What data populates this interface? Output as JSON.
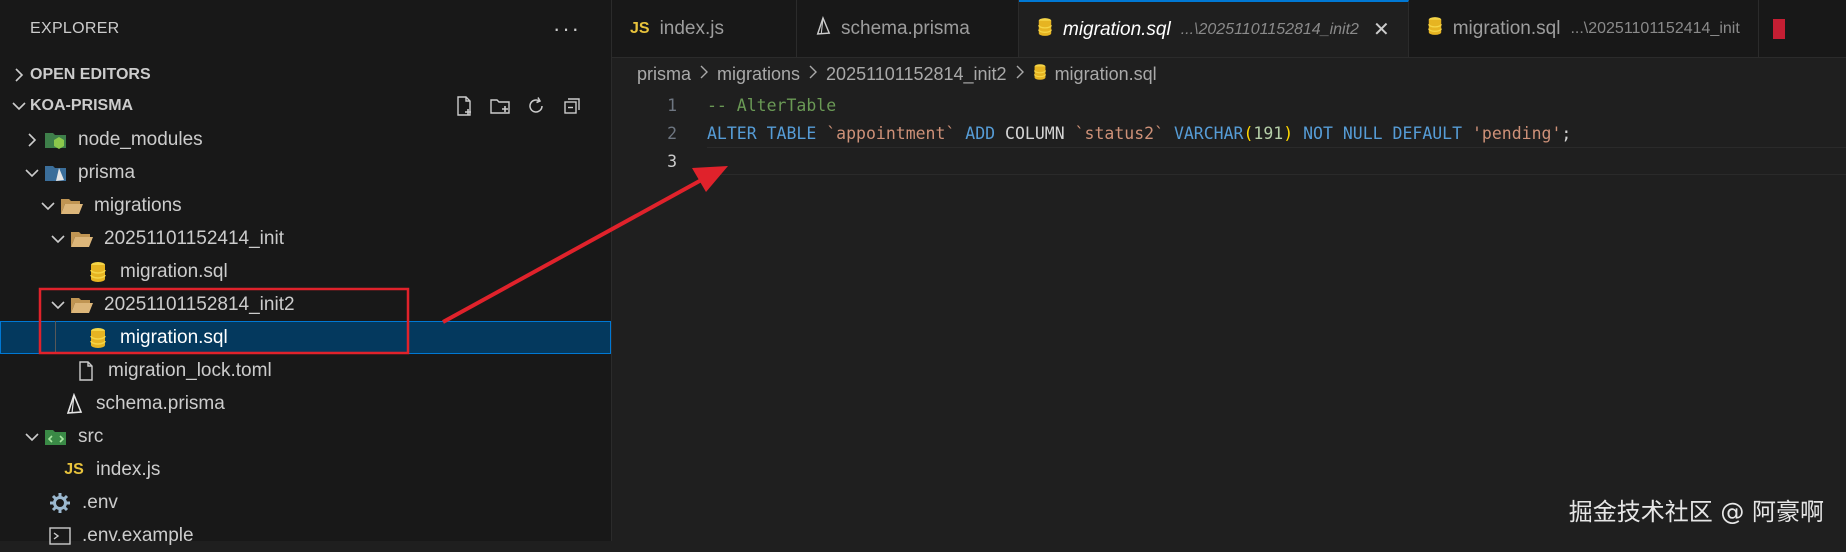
{
  "sidebar": {
    "title": "EXPLORER",
    "more": "···",
    "open_editors": "OPEN EDITORS",
    "project": "KOA-PRISMA",
    "tree": [
      {
        "label": "node_modules"
      },
      {
        "label": "prisma"
      },
      {
        "label": "migrations"
      },
      {
        "label": "20251101152414_init"
      },
      {
        "label": "migration.sql"
      },
      {
        "label": "20251101152814_init2"
      },
      {
        "label": "migration.sql"
      },
      {
        "label": "migration_lock.toml"
      },
      {
        "label": "schema.prisma"
      },
      {
        "label": "src"
      },
      {
        "label": "index.js"
      },
      {
        "label": ".env"
      },
      {
        "label": ".env.example"
      }
    ]
  },
  "tabs": [
    {
      "label": "index.js",
      "badge": "JS"
    },
    {
      "label": "schema.prisma"
    },
    {
      "label": "migration.sql",
      "desc": "...\\20251101152814_init2",
      "close": "✕"
    },
    {
      "label": "migration.sql",
      "desc": "...\\20251101152414_init"
    }
  ],
  "breadcrumb": [
    "prisma",
    "migrations",
    "20251101152814_init2",
    "migration.sql"
  ],
  "code": {
    "line_numbers": [
      "1",
      "2",
      "3"
    ],
    "line1": "-- AlterTable",
    "line2": {
      "kw1": "ALTER TABLE",
      "s1": "`appointment`",
      "kw2": "ADD",
      "p1": "COLUMN",
      "s2": "`status2`",
      "fn": "VARCHAR",
      "lp": "(",
      "num": "191",
      "rp": ")",
      "kw3": "NOT NULL DEFAULT",
      "s3": "'pending'",
      "end": ";"
    }
  },
  "watermark": "掘金技术社区 @ 阿豪啊",
  "colors": {
    "annotation": "#e0222b",
    "selection": "#04395e",
    "accent": "#0078d4"
  }
}
